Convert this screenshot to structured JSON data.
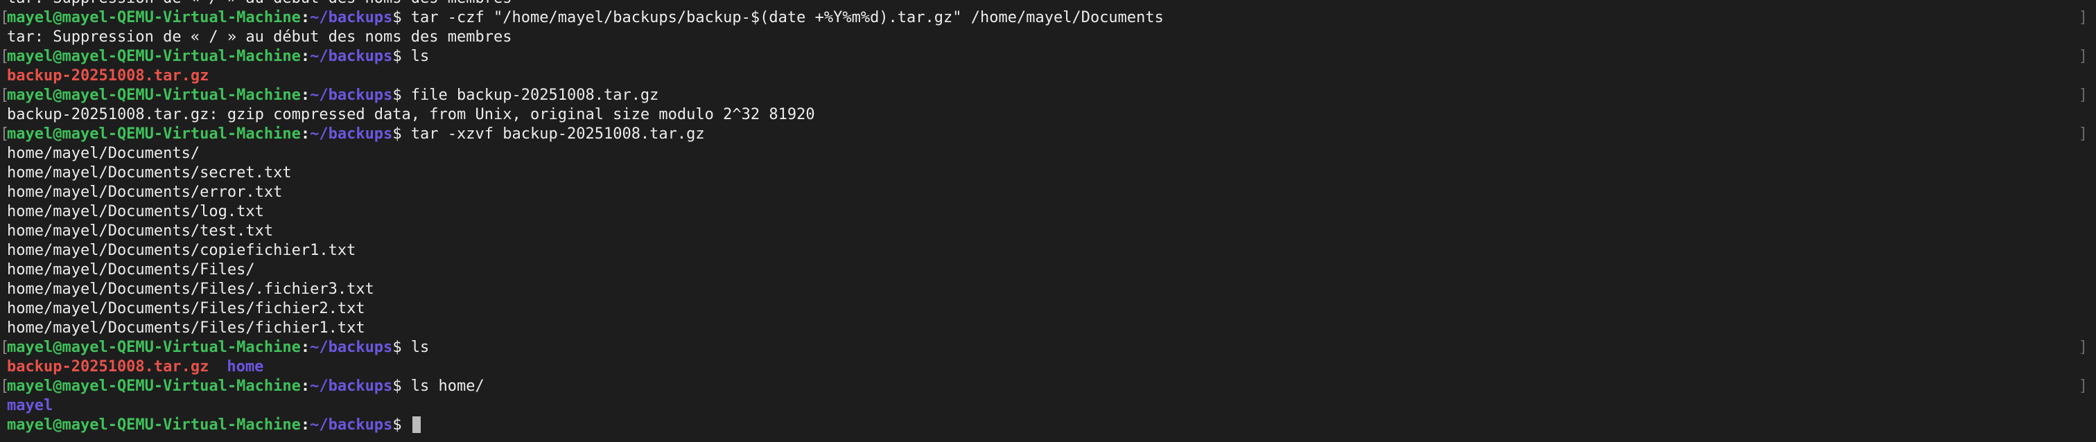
{
  "terminal": {
    "prompt": {
      "user_host": "mayel@mayel-QEMU-Virtual-Machine",
      "colon": ":",
      "path": "~/backups",
      "dollar": "$"
    },
    "lines": {
      "l0": "tar: Suppression de « / » au début des noms des membres",
      "l1_cmd": " tar -czf \"/home/mayel/backups/backup-$(date +%Y%m%d).tar.gz\" /home/mayel/Documents",
      "l2": "tar: Suppression de « / » au début des noms des membres",
      "l3_cmd": " ls",
      "l4_archive": "backup-20251008.tar.gz",
      "l5_cmd": " file backup-20251008.tar.gz",
      "l6": "backup-20251008.tar.gz: gzip compressed data, from Unix, original size modulo 2^32 81920",
      "l7_cmd": " tar -xzvf backup-20251008.tar.gz",
      "l8": "home/mayel/Documents/",
      "l9": "home/mayel/Documents/secret.txt",
      "l10": "home/mayel/Documents/error.txt",
      "l11": "home/mayel/Documents/log.txt",
      "l12": "home/mayel/Documents/test.txt",
      "l13": "home/mayel/Documents/copiefichier1.txt",
      "l14": "home/mayel/Documents/Files/",
      "l15": "home/mayel/Documents/Files/.fichier3.txt",
      "l16": "home/mayel/Documents/Files/fichier2.txt",
      "l17": "home/mayel/Documents/Files/fichier1.txt",
      "l18_cmd": " ls",
      "l19_archive": "backup-20251008.tar.gz",
      "l19_dir": "home",
      "l20_cmd": " ls home/",
      "l21_dir": "mayel",
      "l22_cmd": " "
    },
    "bracket_left": "[",
    "bracket_right": "]"
  },
  "colors": {
    "background": "#1d1d1d",
    "user_host": "#3fc15a",
    "path": "#6a57e0",
    "archive": "#e8524a",
    "directory": "#6a57e0",
    "text": "#ececec"
  }
}
